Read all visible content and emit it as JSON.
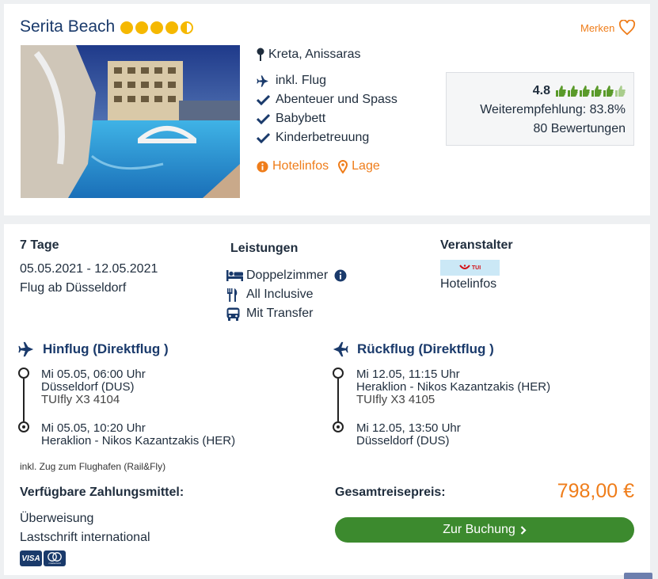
{
  "hotel": {
    "name": "Serita Beach",
    "stars": 4.5,
    "merken_label": "Merken",
    "location": "Kreta, Anissaras",
    "features": [
      "inkl. Flug",
      "Abenteuer und Spass",
      "Babybett",
      "Kinderbetreuung"
    ],
    "feature_icons": [
      "plane-icon",
      "check-icon",
      "check-icon",
      "check-icon"
    ],
    "link_hotelinfos": "Hotelinfos",
    "link_lage": "Lage"
  },
  "rating": {
    "score": "4.8",
    "thumbs": 5.8,
    "recommendation": "Weiterempfehlung: 83.8%",
    "reviews": "80 Bewertungen"
  },
  "offer": {
    "duration": "7 Tage",
    "dates": "05.05.2021 - 12.05.2021",
    "departure": "Flug ab Düsseldorf",
    "services_title": "Leistungen",
    "services": [
      "Doppelzimmer",
      "All Inclusive",
      "Mit Transfer"
    ],
    "operator_title": "Veranstalter",
    "operator_logo": "TUI",
    "operator_link": "Hotelinfos"
  },
  "outbound": {
    "title": "Hinflug (Direktflug )",
    "dep_time": "Mi 05.05, 06:00 Uhr",
    "dep_airport": "Düsseldorf (DUS)",
    "flight": "TUIfly X3 4104",
    "arr_time": "Mi 05.05, 10:20 Uhr",
    "arr_airport": "Heraklion - Nikos Kazantzakis (HER)"
  },
  "return": {
    "title": "Rückflug (Direktflug )",
    "dep_time": "Mi 12.05, 11:15 Uhr",
    "dep_airport": "Heraklion - Nikos Kazantzakis (HER)",
    "flight": "TUIfly X3 4105",
    "arr_time": "Mi 12.05, 13:50 Uhr",
    "arr_airport": "Düsseldorf (DUS)"
  },
  "rail_note": "inkl. Zug zum Flughafen (Rail&Fly)",
  "payment": {
    "title": "Verfügbare Zahlungsmittel:",
    "methods": [
      "Überweisung",
      "Lastschrift international"
    ],
    "logos": [
      "VISA",
      "mastercard"
    ]
  },
  "price": {
    "label": "Gesamtreisepreis:",
    "value": "798,00 €"
  },
  "booking_button": "Zur Buchung",
  "colors": {
    "accent": "#ef7d1a",
    "brand": "#1a3a6b",
    "button": "#3c8a2e",
    "thumb": "#5a9a2a"
  }
}
